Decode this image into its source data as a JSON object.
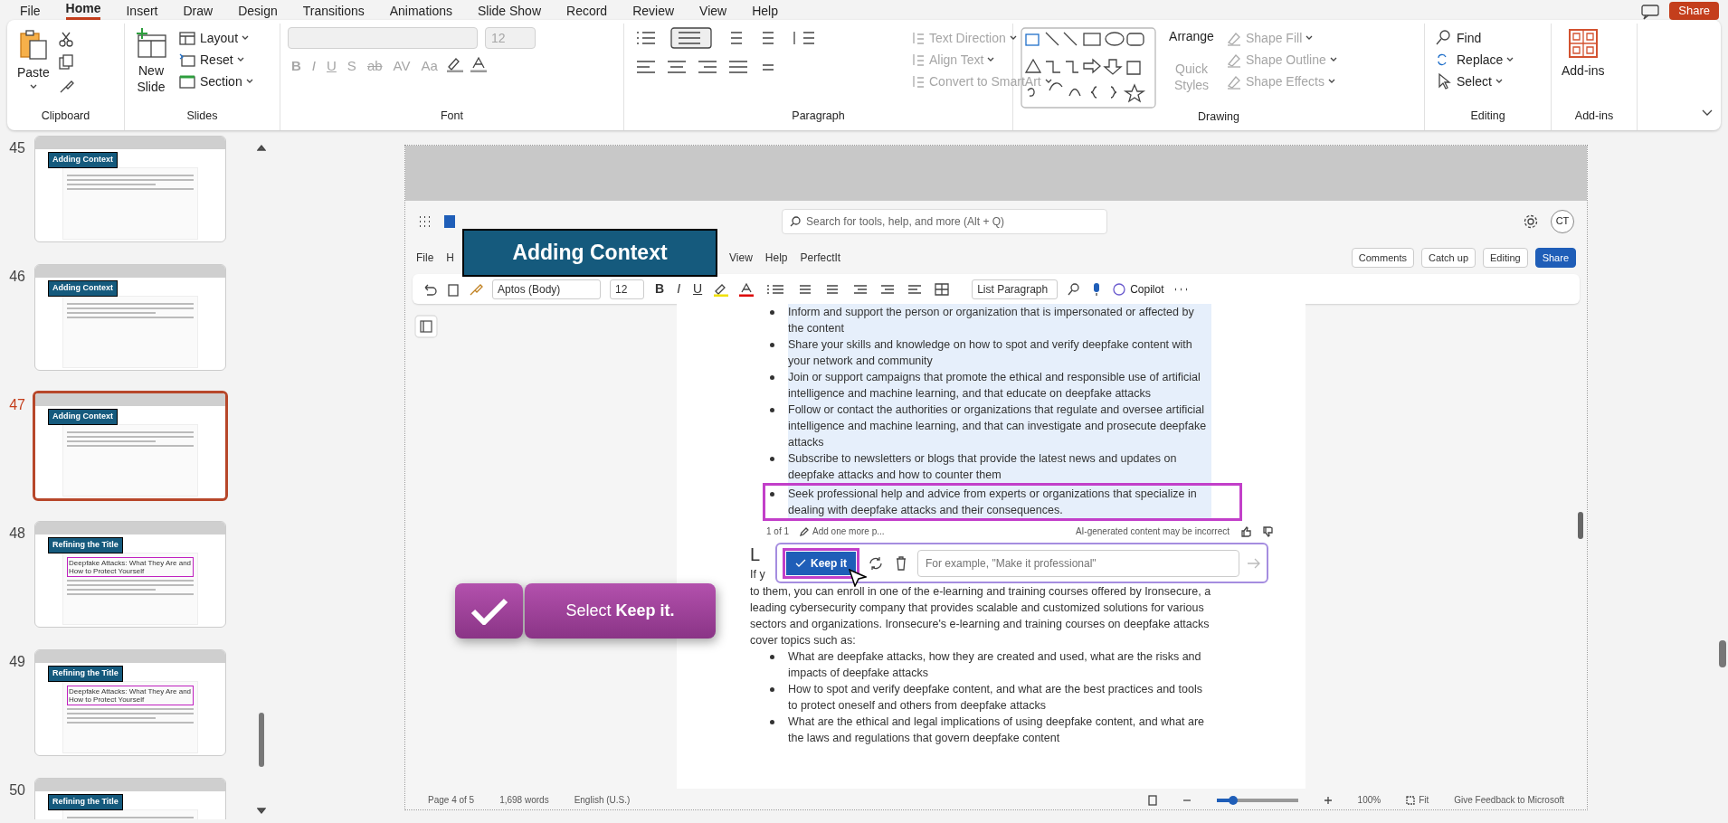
{
  "menu_tabs": [
    {
      "label": "File",
      "selected": false
    },
    {
      "label": "Home",
      "selected": true
    },
    {
      "label": "Insert",
      "selected": false
    },
    {
      "label": "Draw",
      "selected": false
    },
    {
      "label": "Design",
      "selected": false
    },
    {
      "label": "Transitions",
      "selected": false
    },
    {
      "label": "Animations",
      "selected": false
    },
    {
      "label": "Slide Show",
      "selected": false
    },
    {
      "label": "Record",
      "selected": false
    },
    {
      "label": "Review",
      "selected": false
    },
    {
      "label": "View",
      "selected": false
    },
    {
      "label": "Help",
      "selected": false
    }
  ],
  "share_button": "Share",
  "ribbon": {
    "clipboard": {
      "paste": "Paste",
      "label": "Clipboard"
    },
    "slides": {
      "new_slide": "New Slide",
      "items": [
        "Layout",
        "Reset",
        "Section"
      ],
      "label": "Slides"
    },
    "font": {
      "size": "12",
      "styles": [
        "B",
        "I",
        "U",
        "S",
        "ab",
        "AV",
        "Aa"
      ],
      "disabled": true,
      "label": "Font"
    },
    "paragraph": {
      "items": [
        {
          "label": "Text Direction",
          "disabled": true
        },
        {
          "label": "Align Text",
          "disabled": true
        },
        {
          "label": "Convert to SmartArt",
          "disabled": true
        }
      ],
      "label": "Paragraph"
    },
    "drawing": {
      "buttons": [
        {
          "label": "Arrange",
          "disabled": false
        },
        {
          "label": "Quick Styles",
          "disabled": true
        }
      ],
      "items": [
        {
          "label": "Shape Fill",
          "disabled": true
        },
        {
          "label": "Shape Outline",
          "disabled": true
        },
        {
          "label": "Shape Effects",
          "disabled": true
        }
      ],
      "label": "Drawing"
    },
    "editing": {
      "items": [
        "Find",
        "Replace",
        "Select"
      ],
      "label": "Editing"
    },
    "addins": {
      "button": "Add-ins",
      "label": "Add-ins"
    }
  },
  "thumbnails": [
    {
      "number": "45",
      "title": "Adding Context",
      "selected": false
    },
    {
      "number": "46",
      "title": "Adding Context",
      "selected": false
    },
    {
      "number": "47",
      "title": "Adding Context",
      "selected": true
    },
    {
      "number": "48",
      "title": "Refining the Title",
      "headline": "Deepfake Attacks: What They Are and How to Protect Yourself",
      "selected": false
    },
    {
      "number": "49",
      "title": "Refining the Title",
      "headline": "Deepfake Attacks: What They Are and How to Protect Yourself",
      "selected": false
    },
    {
      "number": "50",
      "title": "Refining the Title",
      "selected": false
    }
  ],
  "slide": {
    "banner": "Adding Context",
    "callout": "Select **Keep it.**",
    "word": {
      "search_placeholder": "Search for tools, help, and more (Alt + Q)",
      "avatar": "CT",
      "menu": [
        "File",
        "H",
        "View",
        "Help",
        "PerfectIt"
      ],
      "header_buttons": [
        "Comments",
        "Catch up",
        "Editing",
        "Share"
      ],
      "toolbar": {
        "font": "Aptos (Body)",
        "size": "12",
        "format": [
          "B",
          "I",
          "U"
        ],
        "style": "List Paragraph",
        "copilot": "Copilot"
      },
      "document": {
        "bullets_top": [
          {
            "text": "Inform and support the person or organization that is impersonated or affected by the content",
            "framed": false
          },
          {
            "text": "Share your skills and knowledge on how to spot and verify deepfake content with your network and community",
            "framed": false
          },
          {
            "text": "Join or support campaigns that promote the ethical and responsible use of artificial intelligence and machine learning, and that educate on deepfake attacks",
            "framed": false
          },
          {
            "text": "Follow or contact the authorities or organizations that regulate and oversee artificial intelligence and machine learning, and that can investigate and prosecute deepfake attacks",
            "framed": false
          },
          {
            "text": "Subscribe to newsletters or blogs that provide the latest news and updates on deepfake attacks and how to counter them",
            "framed": false
          },
          {
            "text": "Seek professional help and advice from experts or organizations that specialize in dealing with deepfake attacks and their consequences.",
            "framed": true
          }
        ],
        "ai_bar": {
          "pager": "1 of 1",
          "add": "Add one more p...",
          "notice": "AI-generated content may be incorrect",
          "keep": "Keep it",
          "placeholder": "For example, \"Make it professional\""
        },
        "heading_fragment": "L",
        "paragraph_fragment": "If y",
        "paragraph": "to them, you can enroll in one of the e-learning and training courses offered by Ironsecure, a leading cybersecurity company that provides scalable and customized solutions for various sectors and organizations. Ironsecure's e-learning and training courses on deepfake attacks cover topics such as:",
        "bullets_bottom": [
          "What are deepfake attacks, how they are created and used, what are the risks and impacts of deepfake attacks",
          "How to spot and verify deepfake content, and what are the best practices and tools to protect oneself and others from deepfake attacks",
          "What are the ethical and legal implications of using deepfake content, and what are the laws and regulations that govern deepfake content"
        ]
      },
      "status": {
        "page": "Page 4 of 5",
        "words": "1,698 words",
        "language": "English (U.S.)",
        "zoom": "100%",
        "fit": "Fit",
        "feedback": "Give Feedback to Microsoft",
        "zoom_slider": {
          "level": 0.2
        }
      }
    }
  }
}
